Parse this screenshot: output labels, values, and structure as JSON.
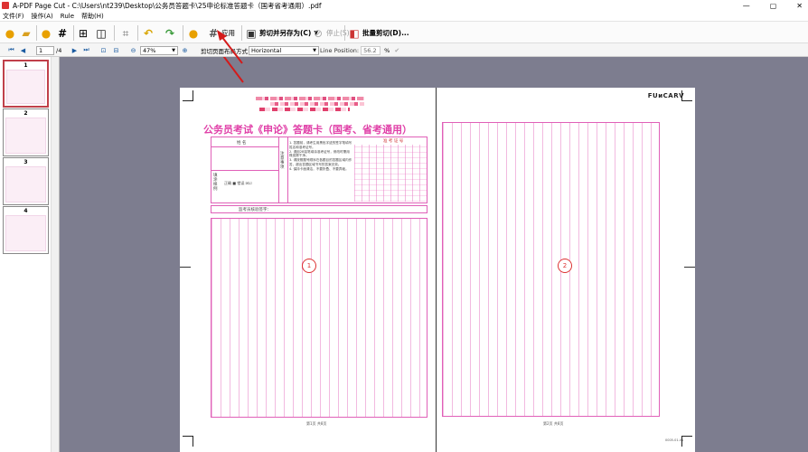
{
  "window": {
    "title": "A-PDF Page Cut - C:\\Users\\nt239\\Desktop\\公务员答题卡\\25申论标准答题卡（国考省考通用）.pdf",
    "controls": [
      "—",
      "▢",
      "✕"
    ]
  },
  "menu": {
    "items": [
      "文件(F)",
      "操作(A)",
      "Rule",
      "帮助(H)"
    ]
  },
  "toolbar": {
    "apply_label": "应用",
    "save_as_label": "剪切并另存为(C)",
    "stop_label": "停止(S)",
    "batch_label": "批量剪切(D)..."
  },
  "nav": {
    "page_value": "1",
    "page_total": "/4",
    "zoom_value": "47%",
    "cut_mode_label": "剪切页面布局方式",
    "cut_mode_value": "Horizontal",
    "line_position_label": "Line Position:",
    "line_position_value": "56.2",
    "percent": "%"
  },
  "thumbnails": [
    "1",
    "2",
    "3",
    "4"
  ],
  "document": {
    "logo": "FUᴎCARV",
    "card_title": "公务员考试《申论》答题卡（国考、省考通用）",
    "name_label": "姓 名",
    "exam_number_label": "准 考 证 号",
    "notice_label": "注意事项",
    "fill_label": "填涂样例",
    "signature_label": "监考员核验签字：",
    "instructions": [
      "1. 答题前，请考生用黑色字迹的签字笔填写姓名和准考证号。",
      "2. 请用2B铅笔填涂准考证号，修改时需用橡皮擦干净。",
      "3. 请按照题号顺序在各题目的答题区域内作答，超出答题区域书写的答案无效。",
      "4. 保持卡面清洁，不要折叠、不要弄破。"
    ],
    "left_footer": "第1页 共8页",
    "right_footer": "第2页 共8页",
    "page_code": "0005-01-01",
    "circle_left": "1",
    "circle_right": "2"
  }
}
